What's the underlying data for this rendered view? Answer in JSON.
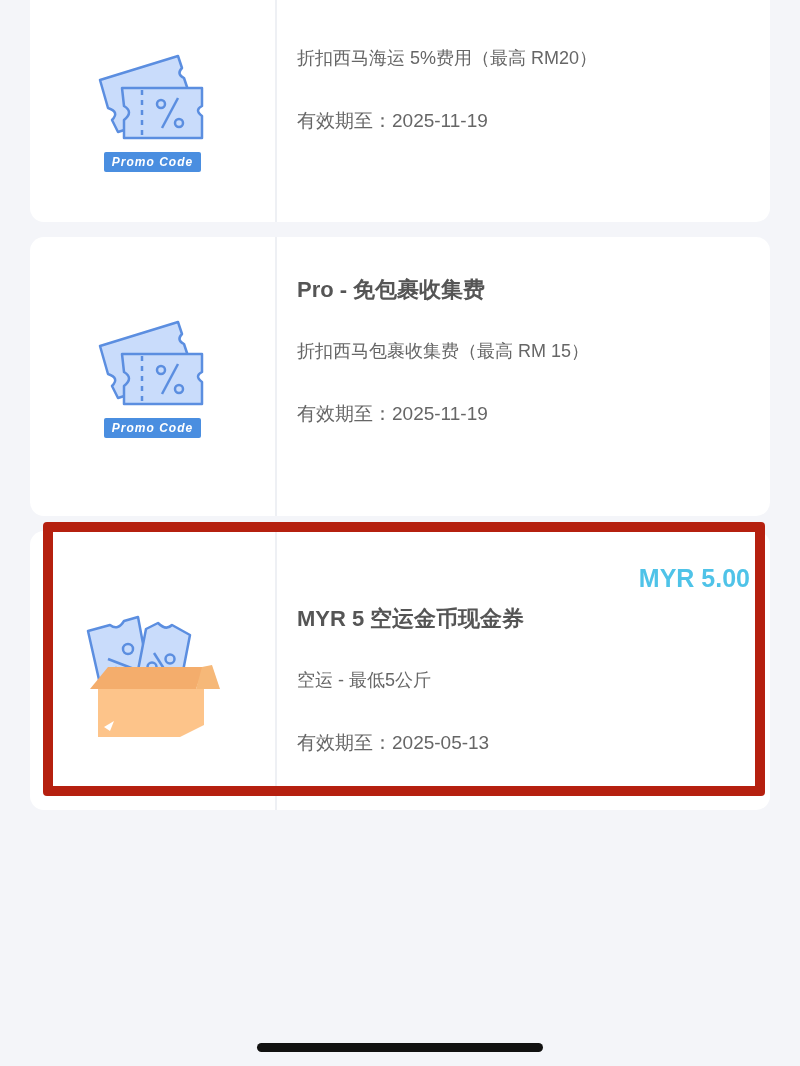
{
  "vouchers": [
    {
      "kind": "promo",
      "icon_label": "Promo Code",
      "description": "折扣西马海运 5%费用（最高 RM20）",
      "validity": "有效期至：2025-11-19",
      "highlighted": false,
      "cut_top": true
    },
    {
      "kind": "promo",
      "icon_label": "Promo Code",
      "title": "Pro - 免包裹收集费",
      "description": "折扣西马包裹收集费（最高 RM 15）",
      "validity": "有效期至：2025-11-19",
      "highlighted": false,
      "cut_top": false
    },
    {
      "kind": "cash",
      "amount": "MYR 5.00",
      "title": "MYR 5 空运金币现金券",
      "description": "空运 - 最低5公斤",
      "validity": "有效期至：2025-05-13",
      "highlighted": true,
      "cut_top": false
    }
  ]
}
